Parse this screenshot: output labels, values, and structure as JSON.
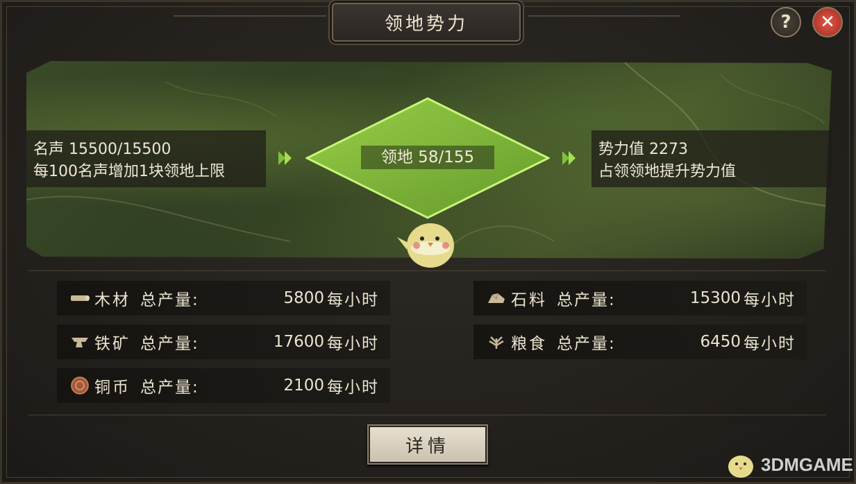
{
  "window": {
    "title": "领地势力"
  },
  "header": {
    "help_glyph": "?",
    "close_glyph": "✕"
  },
  "panel": {
    "fame": {
      "line1": "名声 15500/15500",
      "line2": "每100名声增加1块领地上限"
    },
    "territory": {
      "label": "领地 58/155"
    },
    "influence": {
      "line1": "势力值 2273",
      "line2": "占领领地提升势力值"
    }
  },
  "resources": [
    {
      "name": "木材",
      "total_label": "总产量:",
      "value": "5800",
      "unit": "每小时",
      "icon": "wood-icon"
    },
    {
      "name": "石料",
      "total_label": "总产量:",
      "value": "15300",
      "unit": "每小时",
      "icon": "stone-icon"
    },
    {
      "name": "铁矿",
      "total_label": "总产量:",
      "value": "17600",
      "unit": "每小时",
      "icon": "iron-icon"
    },
    {
      "name": "粮食",
      "total_label": "总产量:",
      "value": "6450",
      "unit": "每小时",
      "icon": "grain-icon"
    },
    {
      "name": "铜币",
      "total_label": "总产量:",
      "value": "2100",
      "unit": "每小时",
      "icon": "copper-coin-icon"
    }
  ],
  "actions": {
    "detail_label": "详情"
  },
  "watermark": {
    "text": "3DMGAME"
  },
  "colors": {
    "territory_green": "#8fd23a",
    "close_red": "#c23a2c",
    "panel_bg": "#24211d"
  }
}
